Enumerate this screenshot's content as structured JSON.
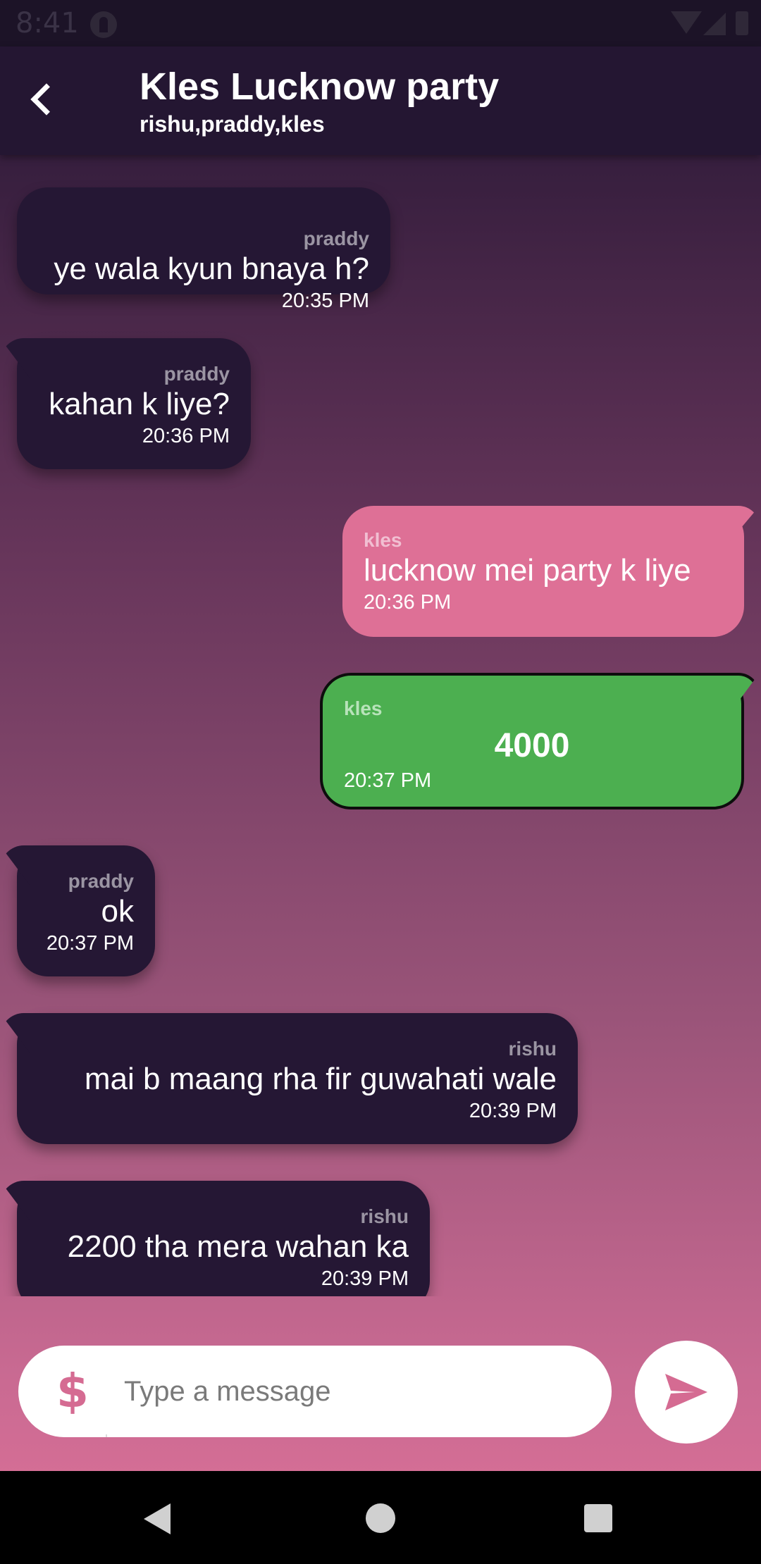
{
  "status_bar": {
    "time": "8:41"
  },
  "header": {
    "title": "Kles Lucknow party",
    "members": "rishu,praddy,kles"
  },
  "messages": [
    {
      "sender": "praddy",
      "text": "ye wala kyun bnaya h?",
      "time": "20:35 PM",
      "direction": "incoming"
    },
    {
      "sender": "praddy",
      "text": "kahan k liye?",
      "time": "20:36 PM",
      "direction": "incoming"
    },
    {
      "sender": "kles",
      "text": "lucknow mei party k liye",
      "time": "20:36 PM",
      "direction": "outgoing"
    },
    {
      "sender": "kles",
      "amount": "4000",
      "time": "20:37 PM",
      "direction": "outgoing",
      "type": "payment"
    },
    {
      "sender": "praddy",
      "text": "ok",
      "time": "20:37 PM",
      "direction": "incoming"
    },
    {
      "sender": "rishu",
      "text": "mai b maang rha fir guwahati wale",
      "time": "20:39 PM",
      "direction": "incoming"
    },
    {
      "sender": "rishu",
      "text": "2200 tha mera wahan ka",
      "time": "20:39 PM",
      "direction": "incoming"
    }
  ],
  "composer": {
    "currency_symbol": "$",
    "placeholder": "Type a message"
  },
  "colors": {
    "incoming_bubble": "#251734",
    "outgoing_bubble": "#de7096",
    "payment_bubble": "#4caf50",
    "accent": "#d56b92"
  },
  "icons": {
    "back": "chevron-left-icon",
    "currency": "dollar-icon",
    "send": "send-icon"
  }
}
